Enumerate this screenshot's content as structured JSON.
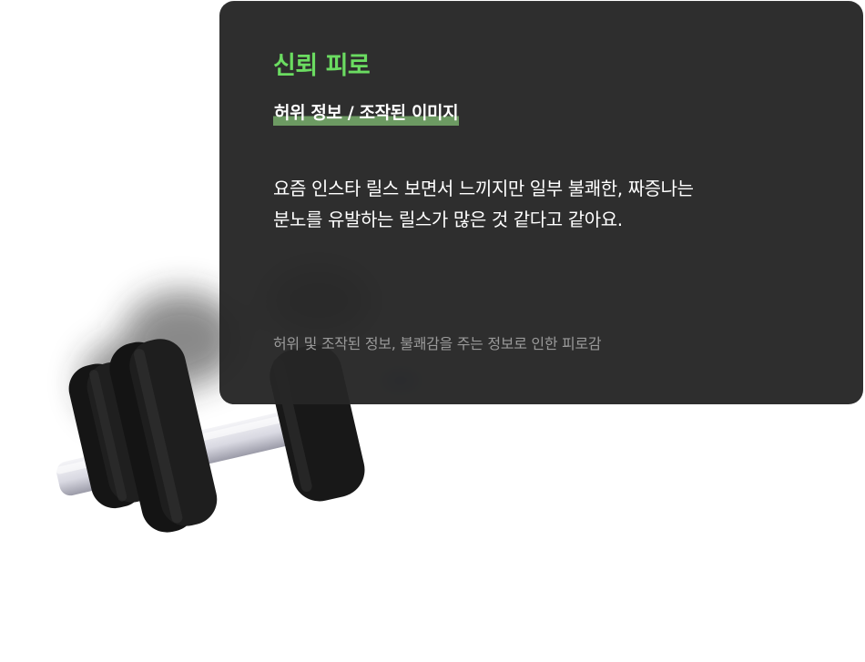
{
  "card": {
    "title": "신뢰 피로",
    "subtitle": "허위 정보 / 조작된 이미지",
    "body_lines": [
      "요즘 인스타 릴스 보면서 느끼지만 일부 불쾌한, 짜증나는",
      "분노를 유발하는 릴스가 많은 것 같다고 같아요."
    ],
    "footer": "허위 및 조작된 정보, 불쾌감을 주는 정보로 인한 피로감"
  },
  "colors": {
    "accent_green": "#6bdc61",
    "highlight_green": "#6c9a62",
    "card_background": "#262626",
    "footer_text": "#9a9a9a"
  },
  "icons": {
    "illustration": "dumbbell-icon"
  }
}
